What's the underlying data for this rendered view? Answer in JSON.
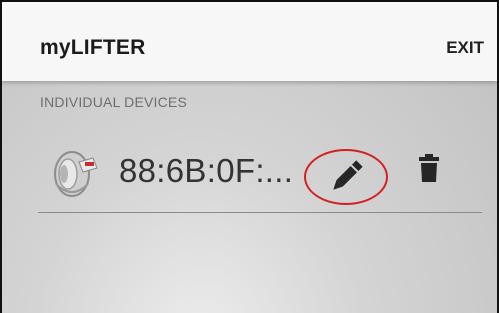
{
  "app": {
    "title": "myLIFTER",
    "exit_label": "EXIT"
  },
  "section": {
    "header": "INDIVIDUAL DEVICES"
  },
  "devices": [
    {
      "name": "88:6B:0F:...",
      "icon": "lifter-device-icon",
      "actions": [
        "edit-pencil-icon",
        "trash-icon"
      ]
    }
  ],
  "colors": {
    "highlight": "#d42020",
    "appbar": "#f7f7f7",
    "background": "#c8c8c8"
  }
}
